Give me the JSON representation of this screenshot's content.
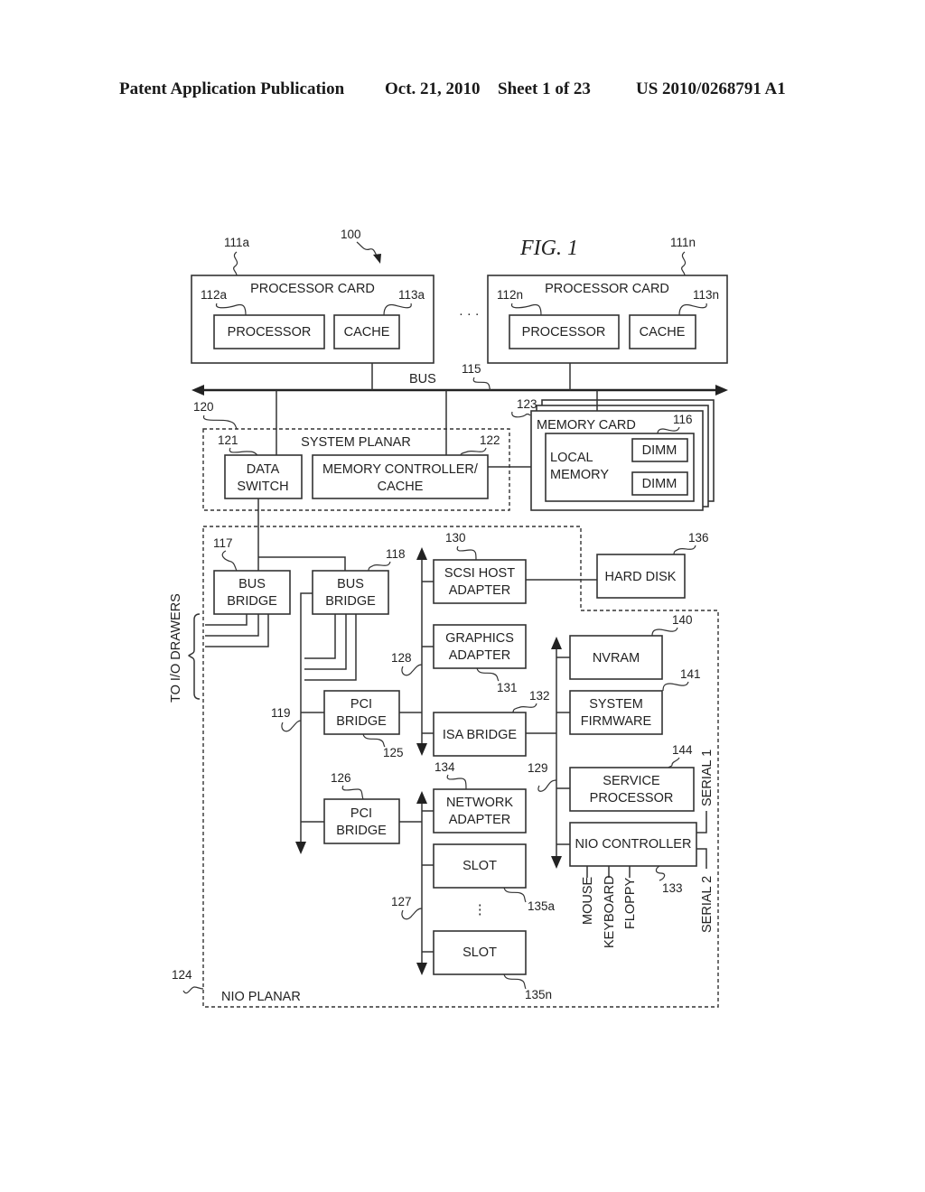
{
  "header": {
    "publication": "Patent Application Publication",
    "date": "Oct. 21, 2010",
    "sheet": "Sheet 1 of 23",
    "number": "US 2010/0268791 A1"
  },
  "figure": {
    "title": "FIG. 1",
    "system_ref": "100",
    "bus": {
      "label": "BUS",
      "ref": "115"
    },
    "processor_cards": [
      {
        "ref": "111a",
        "label": "PROCESSOR CARD",
        "processor": {
          "label": "PROCESSOR",
          "ref": "112a"
        },
        "cache": {
          "label": "CACHE",
          "ref": "113a"
        }
      },
      {
        "ref": "111n",
        "label": "PROCESSOR CARD",
        "processor": {
          "label": "PROCESSOR",
          "ref": "112n"
        },
        "cache": {
          "label": "CACHE",
          "ref": "113n"
        }
      }
    ],
    "ellipsis": "· · ·",
    "system_planar": {
      "label": "SYSTEM PLANAR",
      "ref": "120",
      "data_switch": {
        "line1": "DATA",
        "line2": "SWITCH",
        "ref": "121"
      },
      "memory_controller": {
        "line1": "MEMORY CONTROLLER/",
        "line2": "CACHE",
        "ref": "122"
      }
    },
    "memory_card": {
      "label": "MEMORY CARD",
      "ref": "123",
      "local_memory": {
        "line1": "LOCAL",
        "line2": "MEMORY",
        "ref": "116"
      },
      "dimms": [
        "DIMM",
        "DIMM"
      ]
    },
    "nio_planar": {
      "label": "NIO PLANAR",
      "ref": "124",
      "to_io_drawers": "TO I/O DRAWERS",
      "bus_bridges": [
        {
          "line1": "BUS",
          "line2": "BRIDGE",
          "ref": "117"
        },
        {
          "line1": "BUS",
          "line2": "BRIDGE",
          "ref": "118"
        }
      ],
      "pci_bus_119": "119",
      "pci_bridges": [
        {
          "line1": "PCI",
          "line2": "BRIDGE",
          "ref": "125"
        },
        {
          "line1": "PCI",
          "line2": "BRIDGE",
          "ref": "126"
        }
      ],
      "bus_128": "128",
      "bus_127": "127",
      "bus_129": "129",
      "scsi": {
        "line1": "SCSI HOST",
        "line2": "ADAPTER",
        "ref": "130"
      },
      "graphics": {
        "line1": "GRAPHICS",
        "line2": "ADAPTER",
        "ref": "131"
      },
      "isa_bridge": {
        "label": "ISA BRIDGE",
        "ref": "132"
      },
      "network": {
        "line1": "NETWORK",
        "line2": "ADAPTER",
        "ref": "134"
      },
      "slots": [
        {
          "label": "SLOT",
          "ref": "135a"
        },
        {
          "label": "SLOT",
          "ref": "135n"
        }
      ],
      "slot_ellipsis": "⋮",
      "nvram": {
        "label": "NVRAM",
        "ref": "140"
      },
      "firmware": {
        "line1": "SYSTEM",
        "line2": "FIRMWARE",
        "ref": "141"
      },
      "service_processor": {
        "line1": "SERVICE",
        "line2": "PROCESSOR",
        "ref": "144"
      },
      "nio_controller": {
        "label": "NIO CONTROLLER",
        "ref": "133"
      },
      "ports": {
        "mouse": "MOUSE",
        "keyboard": "KEYBOARD",
        "floppy": "FLOPPY",
        "serial1": "SERIAL 1",
        "serial2": "SERIAL 2"
      }
    },
    "hard_disk": {
      "label": "HARD DISK",
      "ref": "136"
    }
  }
}
